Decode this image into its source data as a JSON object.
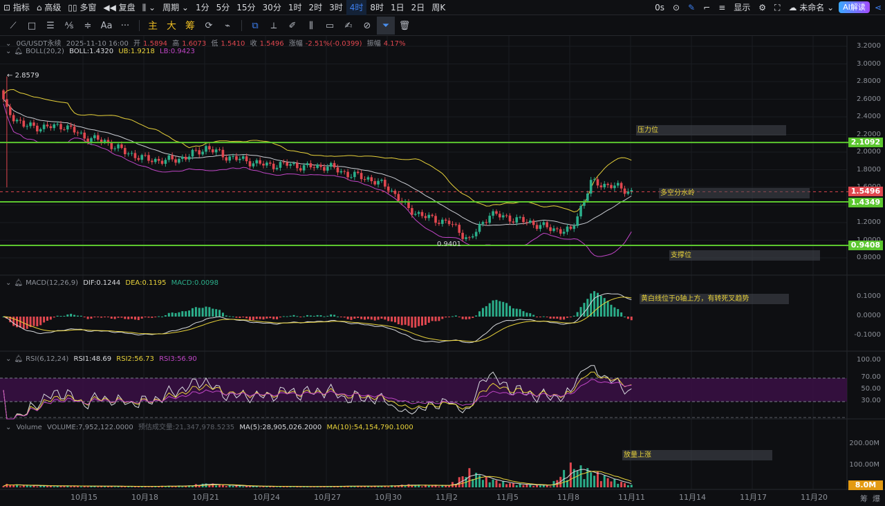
{
  "toolbar": {
    "indicators": "指标",
    "advanced": "高级",
    "multi": "多窗",
    "replay": "复盘",
    "period": "周期",
    "intervals": [
      "1分",
      "5分",
      "15分",
      "30分",
      "1时",
      "2时",
      "3时",
      "4时",
      "8时",
      "1日",
      "2日",
      "周K"
    ],
    "active_interval": "4时",
    "timer": "0s",
    "display": "显示",
    "layout_name": "未命名",
    "ai": "AI解读"
  },
  "draw_tools": {
    "text_tool": "Aa",
    "more": "···",
    "main": "主",
    "big": "大",
    "chips": "筹"
  },
  "header": {
    "symbol": "0G/USDT永续",
    "datetime": "2025-11-10 16:00",
    "open_label": "开",
    "open": "1.5894",
    "high_label": "高",
    "high": "1.6073",
    "low_label": "低",
    "low": "1.5410",
    "close_label": "收",
    "close": "1.5496",
    "change_label": "涨幅",
    "change": "-2.51%(-0.0399)",
    "amp_label": "振幅",
    "amp": "4.17%"
  },
  "boll": {
    "name": "BOLL(20,2)",
    "boll": "BOLL:1.4320",
    "ub": "UB:1.9218",
    "lb": "LB:0.9423"
  },
  "macd": {
    "name": "MACD(12,26,9)",
    "dif": "DIF:0.1244",
    "dea": "DEA:0.1195",
    "macd": "MACD:0.0098"
  },
  "rsi": {
    "name": "RSI(6,12,24)",
    "rsi1": "RSI1:48.69",
    "rsi2": "RSI2:56.73",
    "rsi3": "RSI3:56.90"
  },
  "volume": {
    "name": "Volume",
    "vol": "VOLUME:7,952,122.0000",
    "est": "预估成交量:21,347,978.5235",
    "ma5": "MA(5):28,905,026.2000",
    "ma10": "MA(10):54,154,790.1000"
  },
  "price_axis": [
    "3.2000",
    "3.0000",
    "2.8000",
    "2.6000",
    "2.4000",
    "2.2000",
    "2.0000",
    "1.8000",
    "1.6000",
    "1.4000",
    "1.2000",
    "1.0000",
    "0.8000"
  ],
  "macd_axis": [
    "0.1000",
    "0.0000",
    "-0.1000"
  ],
  "rsi_axis": [
    "100.00",
    "70.00",
    "50.00",
    "30.00"
  ],
  "vol_axis": [
    "200.00M",
    "100.00M"
  ],
  "vol_tag": "8.0M",
  "dates": [
    "10月15",
    "10月18",
    "10月21",
    "10月24",
    "10月27",
    "10月30",
    "11月2",
    "11月5",
    "11月8",
    "11月11",
    "11月14",
    "11月17",
    "11月20"
  ],
  "corner": [
    "筹",
    "爆"
  ],
  "levels": [
    {
      "value": 2.1092,
      "label": "2.1092",
      "color": "#5cc72f"
    },
    {
      "value": 1.4349,
      "label": "1.4349",
      "color": "#5cc72f"
    },
    {
      "value": 0.9408,
      "label": "0.9408",
      "color": "#5cc72f"
    }
  ],
  "last_price": {
    "value": 1.5496,
    "label": "1.5496",
    "color": "#e0474f"
  },
  "annotations": {
    "high_mark": "2.8579",
    "low_mark": "0.9401",
    "resistance": "压力位",
    "watershed": "多空分水岭",
    "support": "支撑位",
    "macd_note": "黄白线位于0轴上方，有转死叉趋势",
    "vol_note": "放量上涨"
  },
  "colors": {
    "up": "#2bae8a",
    "down": "#e0474f",
    "boll_mid": "#c9ccd2",
    "boll_ub": "#e8d23a",
    "boll_lb": "#c046c6"
  },
  "chart_data": {
    "type": "candlestick",
    "interval": "4h",
    "start": "10-11",
    "candles_per_day": 6,
    "daily_close": [
      2.5,
      2.3,
      2.28,
      2.3,
      2.17,
      2.12,
      2.0,
      1.92,
      1.9,
      1.94,
      2.05,
      1.95,
      1.9,
      1.85,
      1.86,
      1.83,
      1.84,
      1.75,
      1.7,
      1.6,
      1.35,
      1.25,
      1.2,
      1.0,
      1.3,
      1.25,
      1.2,
      1.13,
      1.1,
      1.65,
      1.62,
      1.55
    ],
    "daily_volume_m": [
      12,
      8,
      6,
      6,
      5,
      5,
      4,
      4,
      5,
      6,
      14,
      8,
      5,
      4,
      4,
      3,
      4,
      5,
      5,
      6,
      10,
      8,
      8,
      60,
      30,
      15,
      10,
      8,
      80,
      60,
      30,
      8
    ],
    "ylim": [
      0.7,
      3.25
    ]
  }
}
